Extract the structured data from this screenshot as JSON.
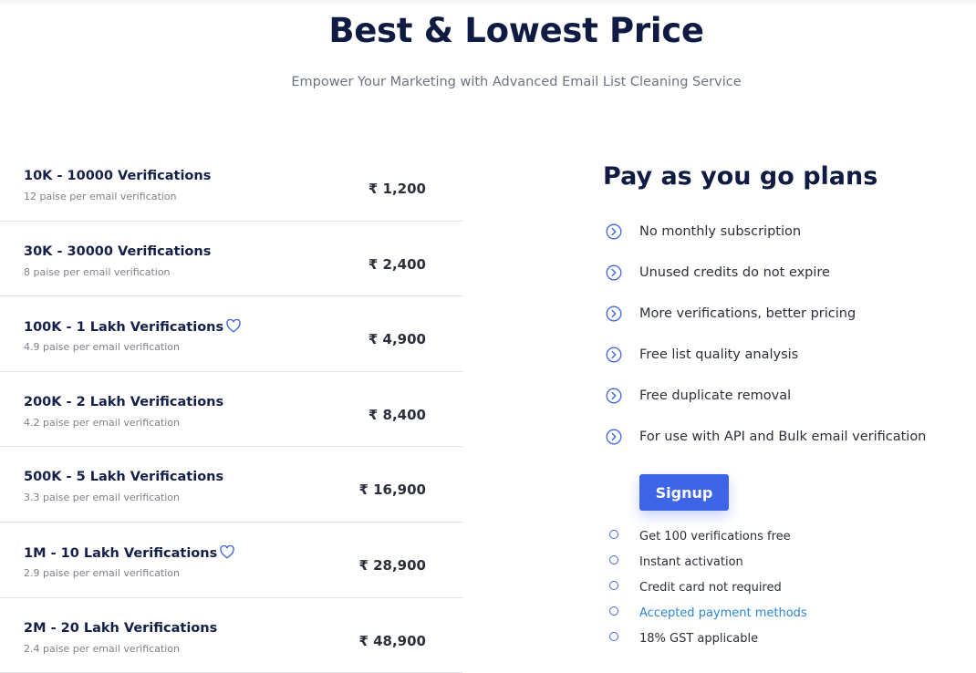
{
  "header": {
    "title": "Best & Lowest Price",
    "subtitle": "Empower Your Marketing with Advanced Email List Cleaning Service"
  },
  "plans": [
    {
      "name": "10K - 10000 Verifications",
      "sub": "12 paise per email verification",
      "price": "₹ 1,200",
      "heart": false
    },
    {
      "name": "30K - 30000 Verifications",
      "sub": "8 paise per email verification",
      "price": "₹ 2,400",
      "heart": false
    },
    {
      "name": "100K - 1 Lakh Verifications",
      "sub": "4.9 paise per email verification",
      "price": "₹ 4,900",
      "heart": true
    },
    {
      "name": "200K - 2 Lakh Verifications",
      "sub": "4.2 paise per email verification",
      "price": "₹ 8,400",
      "heart": false
    },
    {
      "name": "500K - 5 Lakh Verifications",
      "sub": "3.3 paise per email verification",
      "price": "₹ 16,900",
      "heart": false
    },
    {
      "name": "1M - 10 Lakh Verifications",
      "sub": "2.9 paise per email verification",
      "price": "₹ 28,900",
      "heart": true
    },
    {
      "name": "2M - 20 Lakh Verifications",
      "sub": "2.4 paise per email verification",
      "price": "₹ 48,900",
      "heart": false
    }
  ],
  "payg": {
    "title": "Pay as you go plans",
    "features": [
      "No monthly subscription",
      "Unused credits do not expire",
      "More verifications, better pricing",
      "Free list quality analysis",
      "Free duplicate removal",
      "For use with API and Bulk email verification"
    ],
    "signup_label": "Signup",
    "notes": [
      {
        "text": "Get 100 verifications free",
        "link": false
      },
      {
        "text": "Instant activation",
        "link": false
      },
      {
        "text": "Credit card not required",
        "link": false
      },
      {
        "text": "Accepted payment methods",
        "link": true
      },
      {
        "text": "18% GST applicable",
        "link": false
      }
    ]
  },
  "colors": {
    "accent": "#3e64e8",
    "heading": "#0f1b43",
    "link": "#2a86d6"
  },
  "icons": {
    "feature": "chevron-circle-right-icon",
    "favorite": "heart-icon",
    "note": "circle-icon"
  }
}
